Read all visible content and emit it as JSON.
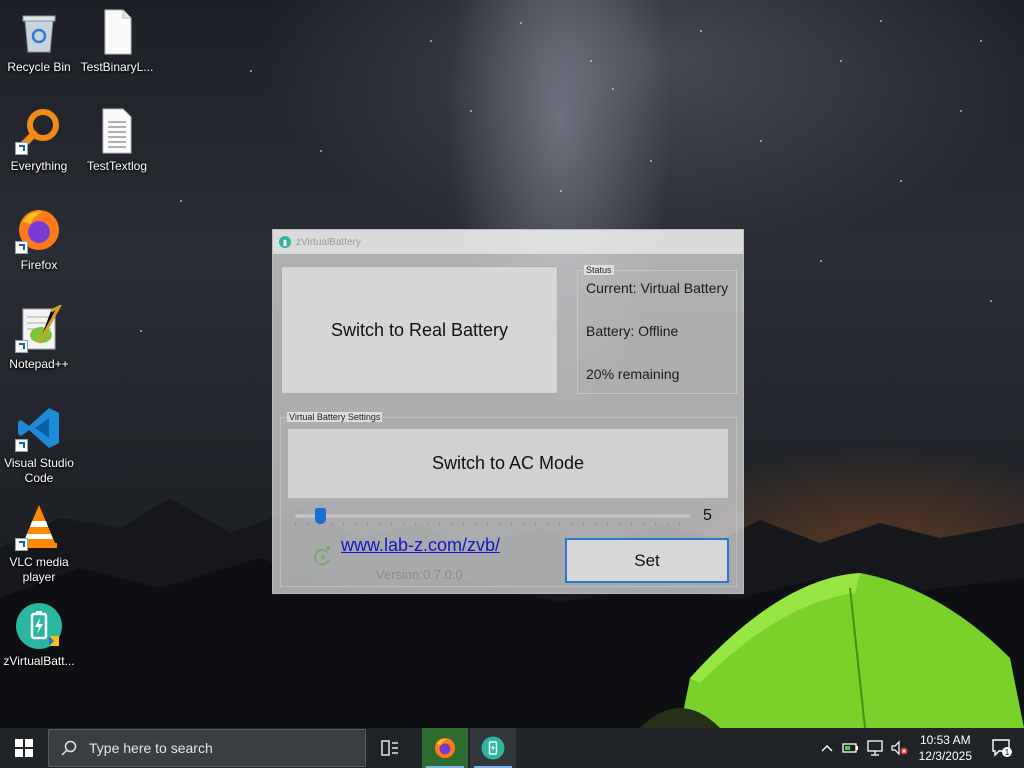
{
  "desktop": {
    "icons": [
      {
        "label": "Recycle Bin",
        "icon": "recycle-bin-icon"
      },
      {
        "label": "TestBinaryL...",
        "icon": "file-icon"
      },
      {
        "label": "Everything",
        "icon": "everything-search-icon"
      },
      {
        "label": "TestTextlog",
        "icon": "text-file-icon"
      },
      {
        "label": "Firefox",
        "icon": "firefox-icon"
      },
      {
        "label": "Notepad++",
        "icon": "notepad-plus-plus-icon"
      },
      {
        "label": "Visual Studio Code",
        "icon": "vscode-icon"
      },
      {
        "label": "VLC media player",
        "icon": "vlc-icon"
      },
      {
        "label": "zVirtualBatt...",
        "icon": "zvirtualbattery-icon"
      }
    ]
  },
  "app": {
    "title": "zVirtualBattery",
    "switch_battery_label": "Switch to Real Battery",
    "status": {
      "legend": "Status",
      "current": "Current: Virtual Battery",
      "battery": "Battery: Offline",
      "remaining": "20% remaining"
    },
    "settings": {
      "legend": "Virtual Battery Settings",
      "switch_ac_label": "Switch to AC Mode",
      "slider_value": "5",
      "slider_level": 0.05,
      "link": "www.lab-z.com/zvb/",
      "version": "Version:0.7.0.0",
      "set_label": "Set"
    }
  },
  "taskbar": {
    "search_placeholder": "Type here to search",
    "time": "10:53 AM",
    "date": "12/3/2025",
    "notification_count": "1",
    "accent": "#7fb4ea"
  }
}
